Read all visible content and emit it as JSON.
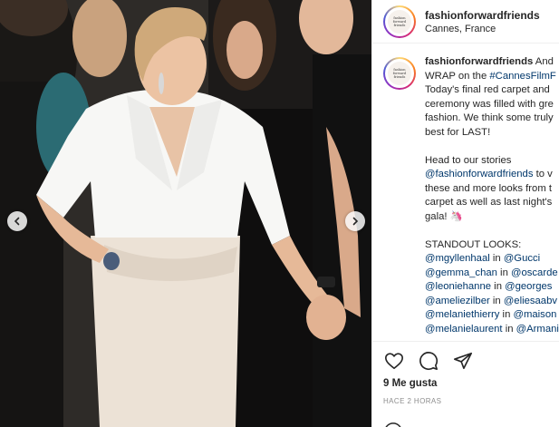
{
  "post": {
    "username": "fashionforwardfriends",
    "location": "Cannes, France",
    "avatar_logo_text": [
      "fashion",
      "forward",
      "friends"
    ]
  },
  "caption": {
    "username": "fashionforwardfriends",
    "lines": [
      [
        {
          "t": " And",
          "link": false
        }
      ],
      [
        {
          "t": "WRAP on the ",
          "link": false
        },
        {
          "t": "#CannesFilmF",
          "link": true
        }
      ],
      [
        {
          "t": "Today's final red carpet and",
          "link": false
        }
      ],
      [
        {
          "t": "ceremony was filled with gre",
          "link": false
        }
      ],
      [
        {
          "t": "fashion. We think some truly",
          "link": false
        }
      ],
      [
        {
          "t": "best for LAST!",
          "link": false
        }
      ],
      [],
      [
        {
          "t": "Head to our stories",
          "link": false
        }
      ],
      [
        {
          "t": "@fashionforwardfriends",
          "link": true
        },
        {
          "t": " to v",
          "link": false
        }
      ],
      [
        {
          "t": "these and more looks from t",
          "link": false
        }
      ],
      [
        {
          "t": "carpet as well as last night's",
          "link": false
        }
      ],
      [
        {
          "t": "gala! 🦄",
          "link": false
        }
      ],
      [],
      [
        {
          "t": "STANDOUT LOOKS:",
          "link": false
        }
      ],
      [
        {
          "t": "@mgyllenhaal",
          "link": true
        },
        {
          "t": " in ",
          "link": false
        },
        {
          "t": "@Gucci",
          "link": true
        }
      ],
      [
        {
          "t": "@gemma_chan",
          "link": true
        },
        {
          "t": " in ",
          "link": false
        },
        {
          "t": "@oscarde",
          "link": true
        }
      ],
      [
        {
          "t": "@leoniehanne",
          "link": true
        },
        {
          "t": " in ",
          "link": false
        },
        {
          "t": "@georges",
          "link": true
        }
      ],
      [
        {
          "t": "@ameliezilber",
          "link": true
        },
        {
          "t": " in ",
          "link": false
        },
        {
          "t": "@eliesaabv",
          "link": true
        }
      ],
      [
        {
          "t": "@melaniethierry",
          "link": true
        },
        {
          "t": " in ",
          "link": false
        },
        {
          "t": "@maison",
          "link": true
        }
      ],
      [
        {
          "t": "@melanielaurent",
          "link": true
        },
        {
          "t": " in ",
          "link": false
        },
        {
          "t": "@Armani",
          "link": true
        }
      ]
    ]
  },
  "actions": {
    "likes": "9 Me gusta",
    "time": "HACE 2 HORAS"
  },
  "icons": {
    "like": "heart-icon",
    "comment": "comment-icon",
    "share": "paper-plane-icon",
    "carousel_prev": "chevron-left-icon",
    "carousel_next": "chevron-right-icon"
  },
  "colors": {
    "link": "#00376b",
    "text": "#262626",
    "muted": "#8e8e8e",
    "border": "#efefef"
  }
}
